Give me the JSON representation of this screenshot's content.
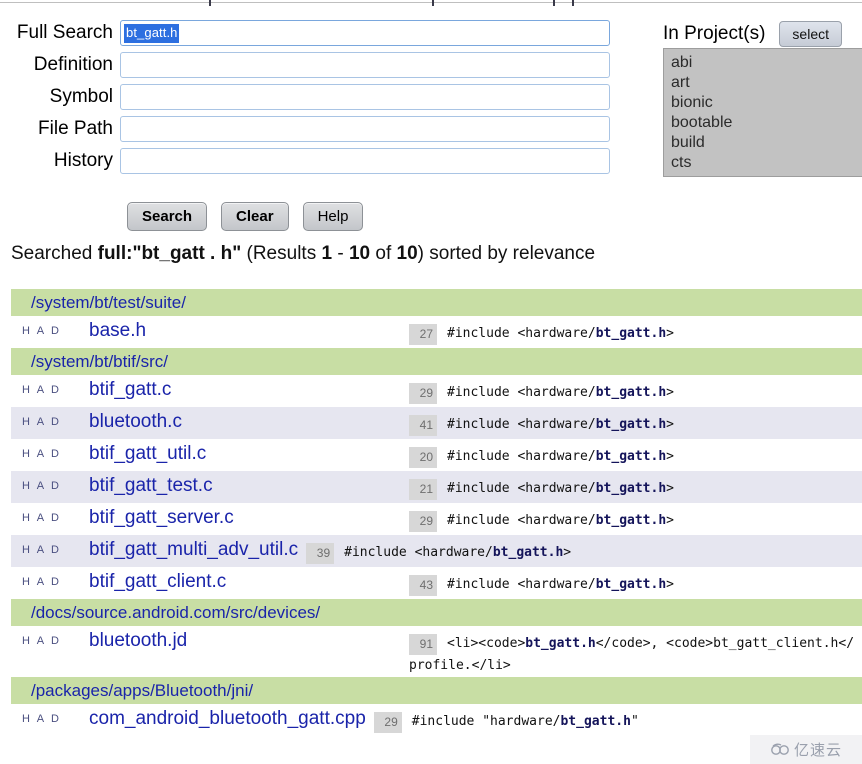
{
  "form": {
    "fields": [
      {
        "label": "Full Search",
        "value": "bt_gatt.h",
        "placeholder": "",
        "name": "full-search"
      },
      {
        "label": "Definition",
        "value": "",
        "placeholder": "",
        "name": "definition"
      },
      {
        "label": "Symbol",
        "value": "",
        "placeholder": "",
        "name": "symbol"
      },
      {
        "label": "File Path",
        "value": "",
        "placeholder": "",
        "name": "file-path"
      },
      {
        "label": "History",
        "value": "",
        "placeholder": "",
        "name": "history"
      }
    ],
    "buttons": {
      "search": "Search",
      "clear": "Clear",
      "help": "Help"
    }
  },
  "projects": {
    "title": "In Project(s)",
    "select_button": "select",
    "options": [
      "abi",
      "art",
      "bionic",
      "bootable",
      "build",
      "cts"
    ]
  },
  "results_header": {
    "searched_prefix": "Searched ",
    "query": "full:\"bt_gatt . h\"",
    "results_word": " (Results ",
    "from": "1",
    "dash": " - ",
    "to": "10",
    "of_word": " of ",
    "total": "10",
    "suffix": ") sorted by relevance"
  },
  "row_actions": "H A D",
  "colors": {
    "dir_green": "#c8dea4",
    "alt_row": "#e6e6f0",
    "link_blue": "#1a24aa",
    "selection_blue": "#2d6fe0",
    "lineno_gray": "#d7d7d7",
    "highlight_navy": "#14145a",
    "slash_red": "#8a1b1b"
  },
  "groups": [
    {
      "dir": "/system/bt/test/suite/",
      "files": [
        {
          "name": "base.h",
          "snippets": [
            {
              "line": "27",
              "pre": "#include <hardware/",
              "hl": "bt_gatt.h",
              "post": ">"
            }
          ]
        }
      ]
    },
    {
      "dir": "/system/bt/btif/src/",
      "files": [
        {
          "name": "btif_gatt.c",
          "snippets": [
            {
              "line": "29",
              "pre": "#include <hardware/",
              "hl": "bt_gatt.h",
              "post": ">"
            }
          ]
        },
        {
          "name": "bluetooth.c",
          "snippets": [
            {
              "line": "41",
              "pre": "#include <hardware/",
              "hl": "bt_gatt.h",
              "post": ">"
            }
          ]
        },
        {
          "name": "btif_gatt_util.c",
          "snippets": [
            {
              "line": "20",
              "pre": "#include <hardware/",
              "hl": "bt_gatt.h",
              "post": ">"
            }
          ]
        },
        {
          "name": "btif_gatt_test.c",
          "snippets": [
            {
              "line": "21",
              "pre": "#include <hardware/",
              "hl": "bt_gatt.h",
              "post": ">"
            }
          ]
        },
        {
          "name": "btif_gatt_server.c",
          "snippets": [
            {
              "line": "29",
              "pre": "#include <hardware/",
              "hl": "bt_gatt.h",
              "post": ">"
            }
          ]
        },
        {
          "name": "btif_gatt_multi_adv_util.c",
          "snippets": [
            {
              "line": "39",
              "pre": "#include <hardware/",
              "hl": "bt_gatt.h",
              "post": ">"
            }
          ]
        },
        {
          "name": "btif_gatt_client.c",
          "snippets": [
            {
              "line": "43",
              "pre": "#include <hardware/",
              "hl": "bt_gatt.h",
              "post": ">"
            }
          ]
        }
      ]
    },
    {
      "dir": "/docs/source.android.com/src/devices/",
      "files": [
        {
          "name": "bluetooth.jd",
          "snippets": [
            {
              "line": "91",
              "pre": "<li><code>",
              "hl": "bt_gatt.h",
              "post": "</code>, <code>bt_gatt_client.h</",
              "cont": "profile.</li>"
            }
          ]
        }
      ]
    },
    {
      "dir": "/packages/apps/Bluetooth/jni/",
      "files": [
        {
          "name": "com_android_bluetooth_gatt.cpp",
          "snippets": [
            {
              "line": "29",
              "pre": "#include \"hardware/",
              "hl": "bt_gatt.h",
              "post": "\""
            }
          ]
        }
      ]
    }
  ],
  "watermark": {
    "text": "亿速云"
  }
}
